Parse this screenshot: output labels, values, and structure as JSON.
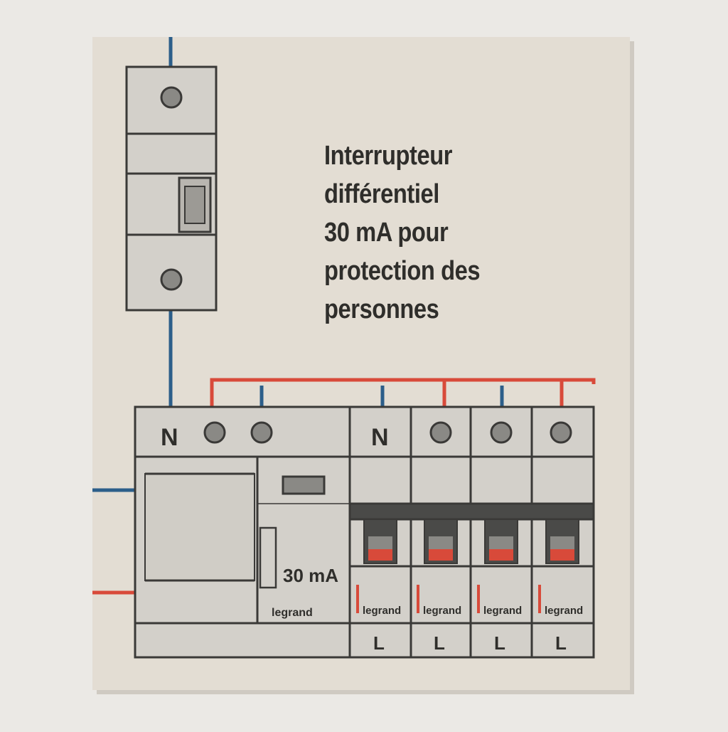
{
  "title_lines": [
    "Interrupteur",
    "différentiel",
    "30 mA pour",
    "protection des",
    "personnes"
  ],
  "differential": {
    "terminal_label": "N",
    "rating": "30 mA",
    "brand": "legrand"
  },
  "breakers": [
    {
      "top_label": "N",
      "brand": "legrand",
      "bottom_label": "L"
    },
    {
      "top_label": "",
      "brand": "legrand",
      "bottom_label": "L"
    },
    {
      "top_label": "",
      "brand": "legrand",
      "bottom_label": "L"
    },
    {
      "top_label": "",
      "brand": "legrand",
      "bottom_label": "L"
    }
  ],
  "colors": {
    "wall": "#ebe9e5",
    "canvas": "#e3ddd3",
    "module": "#d3d0ca",
    "outline": "#3a3937",
    "neutral_wire": "#2c5e8a",
    "phase_wire": "#d84a3a",
    "lever": "#4a4a48"
  }
}
